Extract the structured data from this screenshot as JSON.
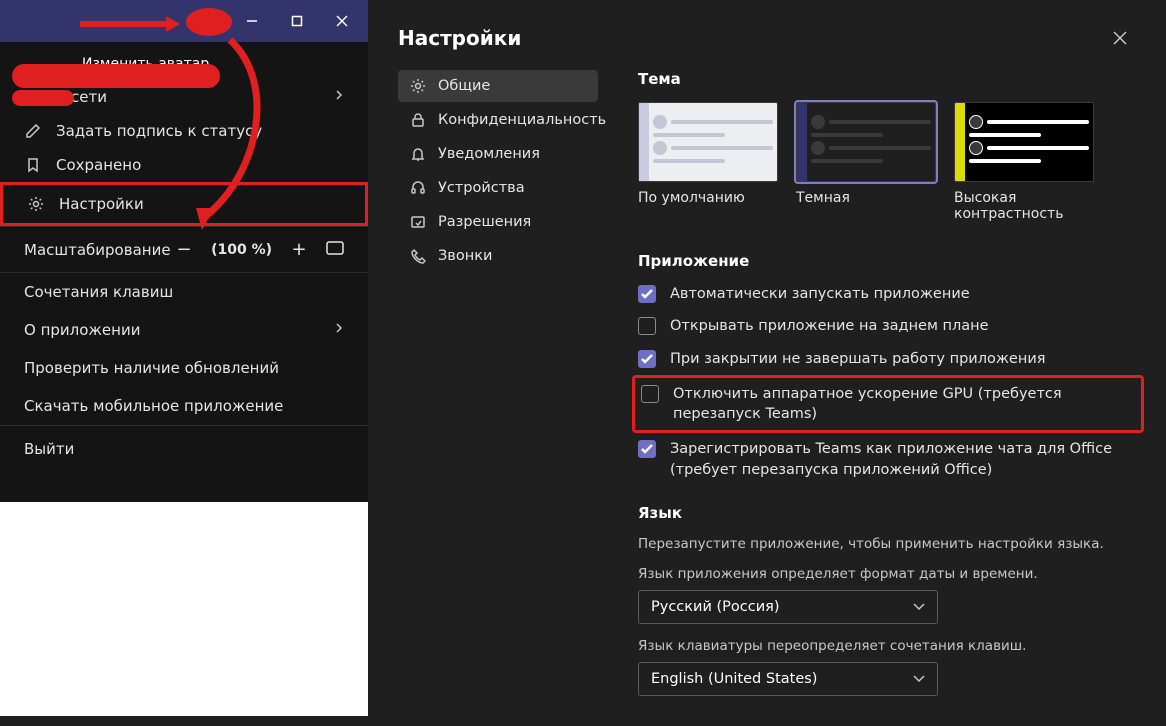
{
  "left": {
    "change_avatar": "Изменить аватар",
    "status": "В сети",
    "set_status": "Задать подпись к статусу",
    "saved": "Сохранено",
    "settings": "Настройки",
    "zoom_label": "Масштабирование",
    "zoom_value": "(100 %)",
    "shortcuts": "Сочетания клавиш",
    "about": "О приложении",
    "check_updates": "Проверить наличие обновлений",
    "download_mobile": "Скачать мобильное приложение",
    "exit": "Выйти"
  },
  "settings": {
    "title": "Настройки",
    "nav": {
      "general": "Общие",
      "privacy": "Конфиденциальность",
      "notifications": "Уведомления",
      "devices": "Устройства",
      "permissions": "Разрешения",
      "calls": "Звонки"
    },
    "theme": {
      "label": "Тема",
      "default": "По умолчанию",
      "dark": "Темная",
      "high_contrast": "Высокая контрастность"
    },
    "app": {
      "label": "Приложение",
      "auto_start": "Автоматически запускать приложение",
      "open_background": "Открывать приложение на заднем плане",
      "keep_running": "При закрытии не завершать работу приложения",
      "disable_gpu": "Отключить аппаратное ускорение GPU (требуется перезапуск Teams)",
      "register_office": "Зарегистрировать Teams как приложение чата для Office (требует перезапуска приложений Office)"
    },
    "language": {
      "label": "Язык",
      "note": "Перезапустите приложение, чтобы применить настройки языка.",
      "app_lang_label": "Язык приложения определяет формат даты и времени.",
      "app_lang_value": "Русский (Россия)",
      "kbd_lang_label": "Язык клавиатуры переопределяет сочетания клавиш.",
      "kbd_lang_value": "English (United States)"
    }
  }
}
